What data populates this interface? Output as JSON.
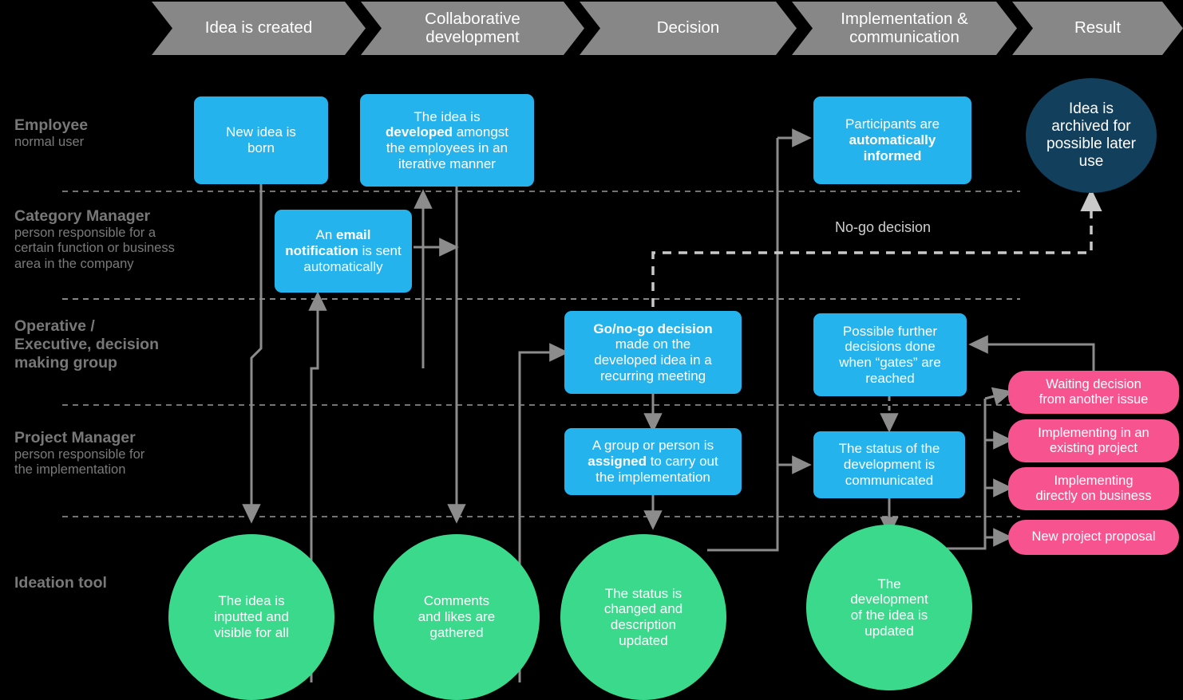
{
  "diagram": {
    "title": "Ideation process swimlane diagram",
    "background": "#000000",
    "colors": {
      "phase_bar": "#878787",
      "blue_node": "#24b3ec",
      "green_node": "#3ad98c",
      "navy_node": "#113f5c",
      "pink_node": "#f7548f",
      "connector": "#8c8c8c",
      "lane_divider": "#b9b9b9",
      "lane_label": "#7a7a7a"
    }
  },
  "phases": [
    {
      "label": "Idea is created"
    },
    {
      "label_line1": "Collaborative",
      "label_line2": "development"
    },
    {
      "label": "Decision"
    },
    {
      "label_line1": "Implementation &",
      "label_line2": "communication"
    },
    {
      "label": "Result"
    }
  ],
  "lanes": [
    {
      "title": "Employee",
      "sub": "normal user"
    },
    {
      "title": "Category Manager",
      "sub_line1": "person responsible for a",
      "sub_line2": "certain function or business",
      "sub_line3": "area in the company"
    },
    {
      "title_line1": "Operative /",
      "title_line2": "Executive, decision",
      "title_line3": "making group",
      "sub": ""
    },
    {
      "title": "Project Manager",
      "sub_line1": "person responsible for",
      "sub_line2": "the implementation"
    },
    {
      "title": "Ideation tool",
      "sub": ""
    }
  ],
  "nodes": {
    "new_idea": {
      "line1": "New idea is",
      "line2": "born"
    },
    "idea_developed": {
      "line1": "The idea is",
      "bold1": "developed",
      "rest1": " amongst",
      "line3": "the employees in an",
      "line4": "iterative manner"
    },
    "email_notification": {
      "pre": "An ",
      "bold": "email notification",
      "post": " is sent automatically"
    },
    "participants_informed": {
      "line1": "Participants are",
      "bold": "automatically informed"
    },
    "idea_archived": {
      "line1": "Idea is",
      "line2": "archived for",
      "line3": "possible later",
      "line4": "use"
    },
    "go_no_go": {
      "bold": "Go/no-go decision",
      "line2": "made on the",
      "line3": "developed idea in a",
      "line4": "recurring meeting"
    },
    "possible_further": {
      "line1": "Possible further",
      "line2": "decisions done",
      "line3": "when “gates” are",
      "line4": "reached"
    },
    "group_assigned": {
      "line1": "A group or person is",
      "bold": "assigned",
      "rest": " to carry out",
      "line3": "the implementation"
    },
    "status_communicated": {
      "line1": "The status of the",
      "line2": "development is",
      "line3": "communicated"
    },
    "idea_inputted": {
      "line1": "The idea is",
      "line2": "inputted and",
      "line3": "visible for all"
    },
    "comments_likes": {
      "line1": "Comments",
      "line2": "and likes are",
      "line3": "gathered"
    },
    "status_changed": {
      "line1": "The status is",
      "line2": "changed and",
      "line3": "description",
      "line4": "updated"
    },
    "development_updated": {
      "line1": "The",
      "line2": "development",
      "line3": "of the idea is",
      "line4": "updated"
    },
    "waiting_decision": {
      "line1": "Waiting decision",
      "line2": "from another issue"
    },
    "implementing_existing": {
      "line1": "Implementing in an",
      "line2": "existing project"
    },
    "implementing_direct": {
      "line1": "Implementing",
      "line2": "directly on business"
    },
    "new_project_proposal": {
      "line1": "New project proposal"
    }
  },
  "edge_labels": {
    "no_go": "No-go decision"
  }
}
